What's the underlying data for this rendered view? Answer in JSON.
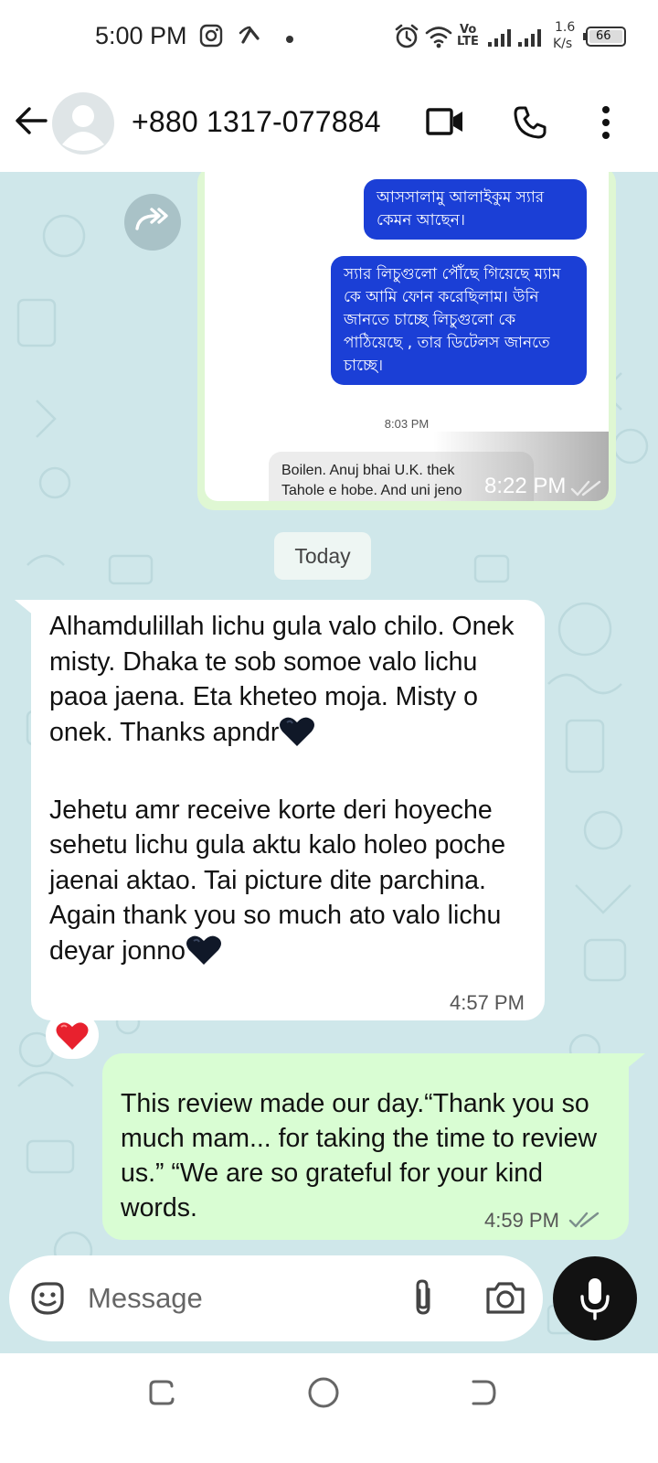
{
  "status_bar": {
    "time": "5:00 PM",
    "net_speed_value": "1.6",
    "net_speed_unit": "K/s",
    "volte_top": "Vo",
    "volte_bottom": "LTE",
    "battery": "66",
    "icons": [
      "instagram-icon",
      "signal-app-icon",
      "dot-icon",
      "alarm-icon",
      "wifi-icon",
      "signal-bars-icon",
      "battery-icon"
    ]
  },
  "header": {
    "contact": "+880 1317-077884",
    "icons": [
      "back-arrow-icon",
      "avatar-icon",
      "video-call-icon",
      "phone-icon",
      "more-vert-icon"
    ]
  },
  "chat": {
    "forwarded_screenshot": {
      "sms_1": "আসসালামু আলাইকুম স্যার কেমন আছেন।",
      "sms_2": "স্যার লিচুগুলো পৌঁছে গিয়েছে ম্যাম কে আমি ফোন করেছিলাম। উনি জানতে চাচ্ছে লিচুগুলো কে পাঠিয়েছে , তার ডিটেলস জানতে চাচ্ছে।",
      "sms_time": "8:03 PM",
      "reply_line_1": "Boilen. Anuj bhai U.K. thek",
      "reply_line_2": "Tahole e hobe. And uni jeno",
      "time": "8:22 PM"
    },
    "date_divider": "Today",
    "incoming": {
      "para_1": "Alhamdulillah lichu gula valo chilo. Onek misty. Dhaka te sob somoe valo lichu paoa jaena. Eta kheteo moja. Misty o onek. Thanks apndr",
      "para_2": "Jehetu amr receive korte deri hoyeche sehetu lichu gula aktu kalo holeo poche jaenai aktao. Tai picture dite parchina. Again thank you so much ato valo lichu deyar jonno",
      "emoji": "black-heart-icon",
      "time": "4:57 PM",
      "reaction": "red-heart-icon"
    },
    "outgoing": {
      "text": "This review made our day.“Thank you so much mam... for taking the time to review us.” “We are so grateful for your kind words.",
      "time": "4:59 PM",
      "status": "double-check-icon"
    }
  },
  "composer": {
    "placeholder": "Message",
    "icons": [
      "sticker-icon",
      "attach-icon",
      "camera-icon",
      "mic-icon"
    ]
  },
  "nav": {
    "icons": [
      "recent-apps-icon",
      "home-icon",
      "back-icon"
    ]
  },
  "colors": {
    "chat_bg": "#cfe7ea",
    "incoming_bubble": "#ffffff",
    "outgoing_bubble": "#d9fdd3",
    "sms_bubble": "#1b3fd6",
    "mic_button": "#121212",
    "reaction_heart": "#e8212e"
  }
}
